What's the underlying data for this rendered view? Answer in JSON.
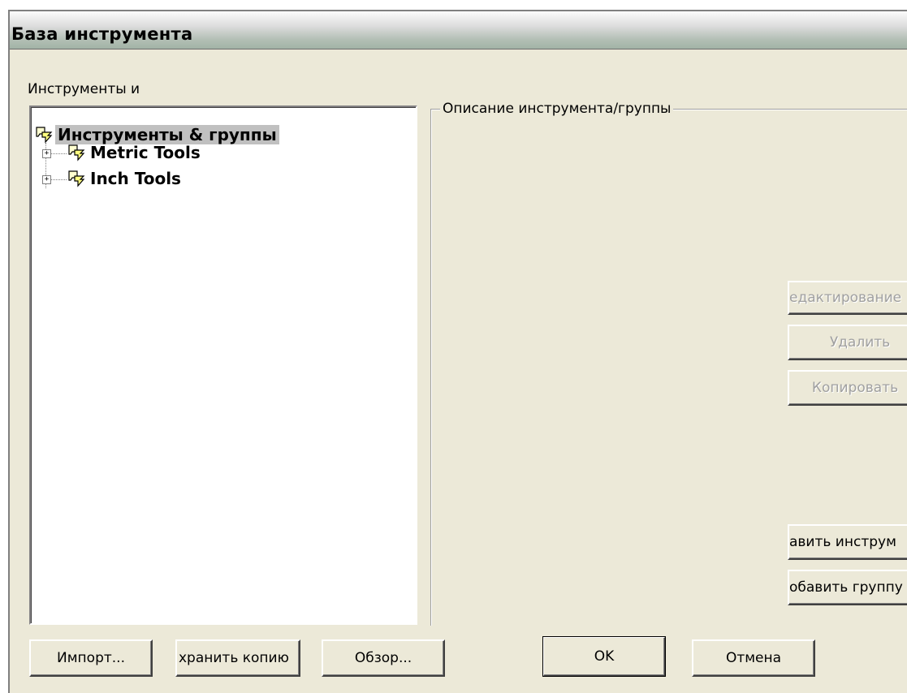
{
  "window": {
    "title": "База инструмента"
  },
  "tree_panel": {
    "label": "Инструменты и",
    "items": [
      {
        "label": "Инструменты & группы",
        "selected": true,
        "icon": "tool-group-icon"
      },
      {
        "label": "Metric Tools",
        "expander": "+",
        "icon": "tool-group-icon"
      },
      {
        "label": "Inch Tools",
        "expander": "+",
        "icon": "tool-group-icon"
      }
    ]
  },
  "description_group": {
    "legend": "Описание инструмента/группы"
  },
  "side_buttons": {
    "edit": "едактирование",
    "delete": "Удалить",
    "copy": "Копировать",
    "add_tool": "авить инструм",
    "add_group": "обавить группу"
  },
  "bottom_buttons": {
    "import": "Импорт...",
    "save_copy": "хранить копию",
    "browse": "Обзор...",
    "ok": "OK",
    "cancel": "Отмена"
  },
  "colors": {
    "dialog_bg": "#ece9d8",
    "selection_bg": "#c0c0c0",
    "disabled_text": "#a0a0a0"
  }
}
